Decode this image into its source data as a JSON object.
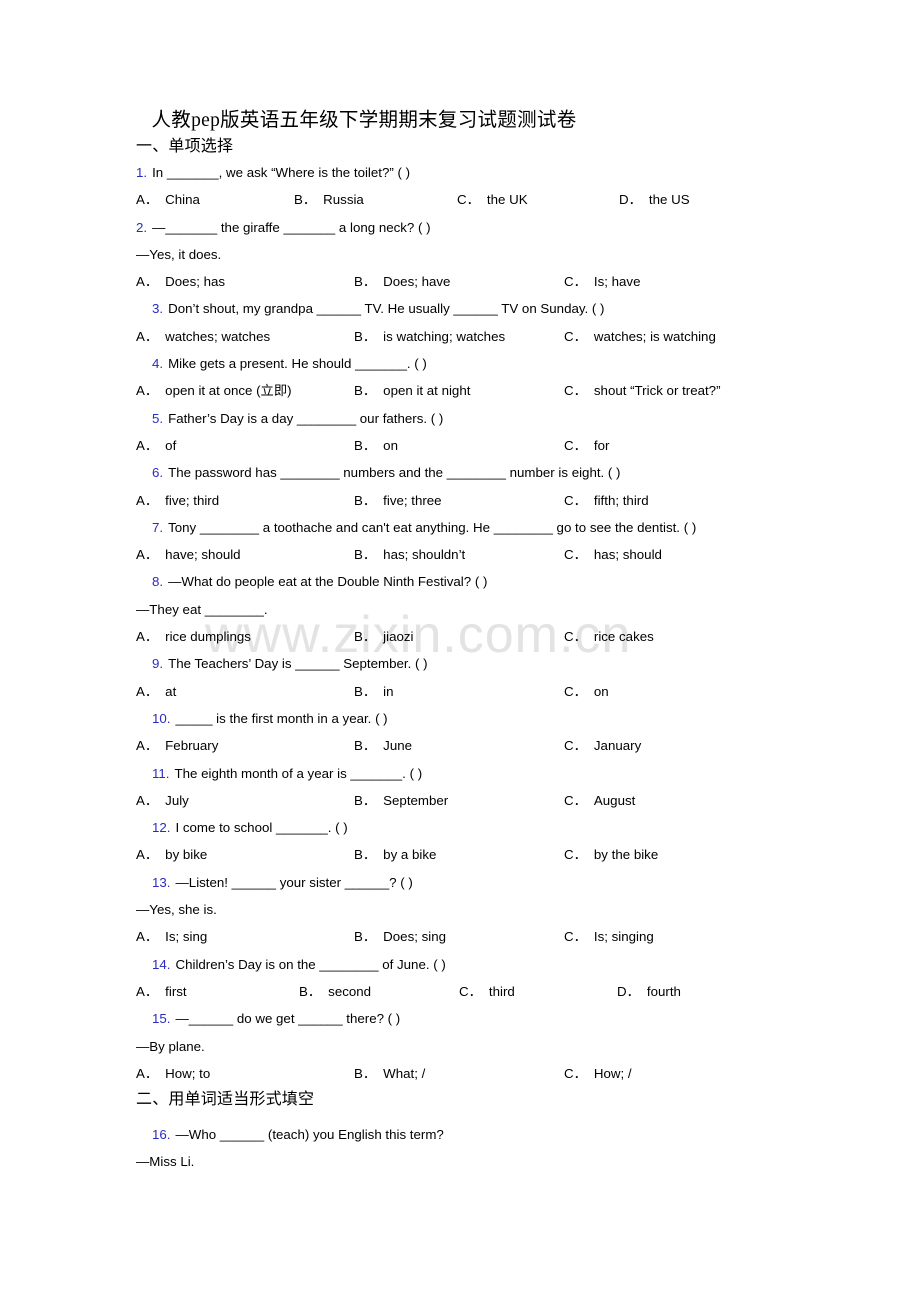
{
  "document": {
    "title": "人教pep版英语五年级下学期期末复习试题测试卷",
    "watermark": "www.zixin.com.cn",
    "accent_number_color": "#2b2bc4"
  },
  "sections": [
    {
      "heading": "一、单项选择"
    },
    {
      "heading": "二、用单词适当形式填空"
    }
  ],
  "questions": [
    {
      "num": "1.",
      "stem": "In _______, we ask “Where is the toilet?” (   )",
      "options": [
        {
          "label": "A．",
          "text": "China"
        },
        {
          "label": "B．",
          "text": "Russia"
        },
        {
          "label": "C．",
          "text": "the UK"
        },
        {
          "label": "D．",
          "text": "the US"
        }
      ]
    },
    {
      "num": "2.",
      "stem": "—_______ the giraffe _______ a long neck? (  )",
      "reply": "—Yes, it does.",
      "options": [
        {
          "label": "A．",
          "text": "Does; has"
        },
        {
          "label": "B．",
          "text": "Does; have"
        },
        {
          "label": "C．",
          "text": "Is; have"
        }
      ]
    },
    {
      "num": "3.",
      "stem": "Don’t shout, my grandpa ______ TV. He usually ______ TV on Sunday. (  )",
      "options": [
        {
          "label": "A．",
          "text": "watches; watches"
        },
        {
          "label": "B．",
          "text": "is watching; watches"
        },
        {
          "label": "C．",
          "text": "watches; is watching"
        }
      ]
    },
    {
      "num": "4.",
      "stem": "Mike gets a present. He should _______. (  )",
      "options": [
        {
          "label": "A．",
          "text": "open it at once (立即)"
        },
        {
          "label": "B．",
          "text": "open it at night"
        },
        {
          "label": "C．",
          "text": "shout “Trick or treat?”"
        }
      ]
    },
    {
      "num": "5.",
      "stem": "Father’s Day is a day ________ our fathers. (   )",
      "options": [
        {
          "label": "A．",
          "text": "of"
        },
        {
          "label": "B．",
          "text": "on"
        },
        {
          "label": "C．",
          "text": "for"
        }
      ]
    },
    {
      "num": "6.",
      "stem": "The password has ________ numbers and the ________ number is eight. (    )",
      "options": [
        {
          "label": "A．",
          "text": "five; third"
        },
        {
          "label": "B．",
          "text": "five; three"
        },
        {
          "label": "C．",
          "text": "fifth; third"
        }
      ]
    },
    {
      "num": "7.",
      "stem": "Tony ________ a toothache and can't eat anything. He ________ go to see the dentist. (    )",
      "options": [
        {
          "label": "A．",
          "text": "have; should"
        },
        {
          "label": "B．",
          "text": "has; shouldn’t"
        },
        {
          "label": "C．",
          "text": "has; should"
        }
      ]
    },
    {
      "num": "8.",
      "stem": "—What do people eat at the Double Ninth Festival? (    )",
      "reply": "—They eat ________.",
      "options": [
        {
          "label": "A．",
          "text": "rice dumplings"
        },
        {
          "label": "B．",
          "text": "jiaozi"
        },
        {
          "label": "C．",
          "text": "rice cakes"
        }
      ]
    },
    {
      "num": "9.",
      "stem": "The Teachers’ Day is ______ September. (  )",
      "options": [
        {
          "label": "A．",
          "text": "at"
        },
        {
          "label": "B．",
          "text": "in"
        },
        {
          "label": "C．",
          "text": "on"
        }
      ]
    },
    {
      "num": "10.",
      "stem": "_____ is the first month in a year.  (   )",
      "options": [
        {
          "label": "A．",
          "text": "February"
        },
        {
          "label": "B．",
          "text": "June"
        },
        {
          "label": "C．",
          "text": "January"
        }
      ]
    },
    {
      "num": "11.",
      "stem": "The eighth month of a year is _______. (  )",
      "options": [
        {
          "label": "A．",
          "text": "July"
        },
        {
          "label": "B．",
          "text": "September"
        },
        {
          "label": "C．",
          "text": "August"
        }
      ]
    },
    {
      "num": "12.",
      "stem": "I come to school _______. (  )",
      "options": [
        {
          "label": "A．",
          "text": "by bike"
        },
        {
          "label": "B．",
          "text": "by a bike"
        },
        {
          "label": "C．",
          "text": "by the bike"
        }
      ]
    },
    {
      "num": "13.",
      "stem": "—Listen! ______ your sister ______? (   )",
      "reply": "—Yes, she is.",
      "options": [
        {
          "label": "A．",
          "text": "Is; sing"
        },
        {
          "label": "B．",
          "text": "Does; sing"
        },
        {
          "label": "C．",
          "text": "Is; singing"
        }
      ]
    },
    {
      "num": "14.",
      "stem": "Children’s Day is on the ________ of June. (  )",
      "options": [
        {
          "label": "A．",
          "text": "first"
        },
        {
          "label": "B．",
          "text": "second"
        },
        {
          "label": "C．",
          "text": "third"
        },
        {
          "label": "D．",
          "text": "fourth"
        }
      ]
    },
    {
      "num": "15.",
      "stem": "—______ do we get ______ there? (   )",
      "reply": "—By plane.",
      "options": [
        {
          "label": "A．",
          "text": "How; to"
        },
        {
          "label": "B．",
          "text": "What; /"
        },
        {
          "label": "C．",
          "text": "How; /"
        }
      ]
    },
    {
      "num": "16.",
      "stem": "—Who ______ (teach) you English this term?",
      "reply": "—Miss Li."
    }
  ]
}
